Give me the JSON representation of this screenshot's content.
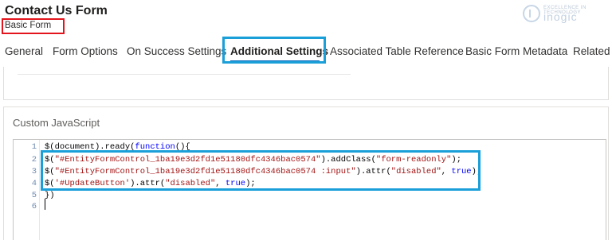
{
  "header": {
    "title": "Contact Us Form",
    "subtitle": "Basic Form",
    "logo_small": "EXCELLENCE IN TECHNOLOGY",
    "logo_text": "inogic"
  },
  "tabs": [
    {
      "label": "General"
    },
    {
      "label": "Form Options"
    },
    {
      "label": "On Success Settings"
    },
    {
      "label": "Additional Settings"
    },
    {
      "label": "Associated Table Reference"
    },
    {
      "label": "Basic Form Metadata"
    },
    {
      "label": "Related"
    }
  ],
  "active_tab": "Additional Settings",
  "section": {
    "label": "Custom JavaScript"
  },
  "editor": {
    "line_numbers": [
      "1",
      "2",
      "3",
      "4",
      "5",
      "6"
    ],
    "lines": [
      "$(document).ready(function(){",
      "$(\"#EntityFormControl_1ba19e3d2fd1e51180dfc4346bac0574\").addClass(\"form-readonly\");",
      "$(\"#EntityFormControl_1ba19e3d2fd1e51180dfc4346bac0574 :input\").attr(\"disabled\", true);",
      "$('#UpdateButton').attr(\"disabled\", true);",
      "})",
      ""
    ]
  },
  "colors": {
    "highlight_blue": "#1a9fd9",
    "highlight_red": "#e3141b",
    "string_color": "#a31515",
    "keyword_color": "#0000ff"
  }
}
